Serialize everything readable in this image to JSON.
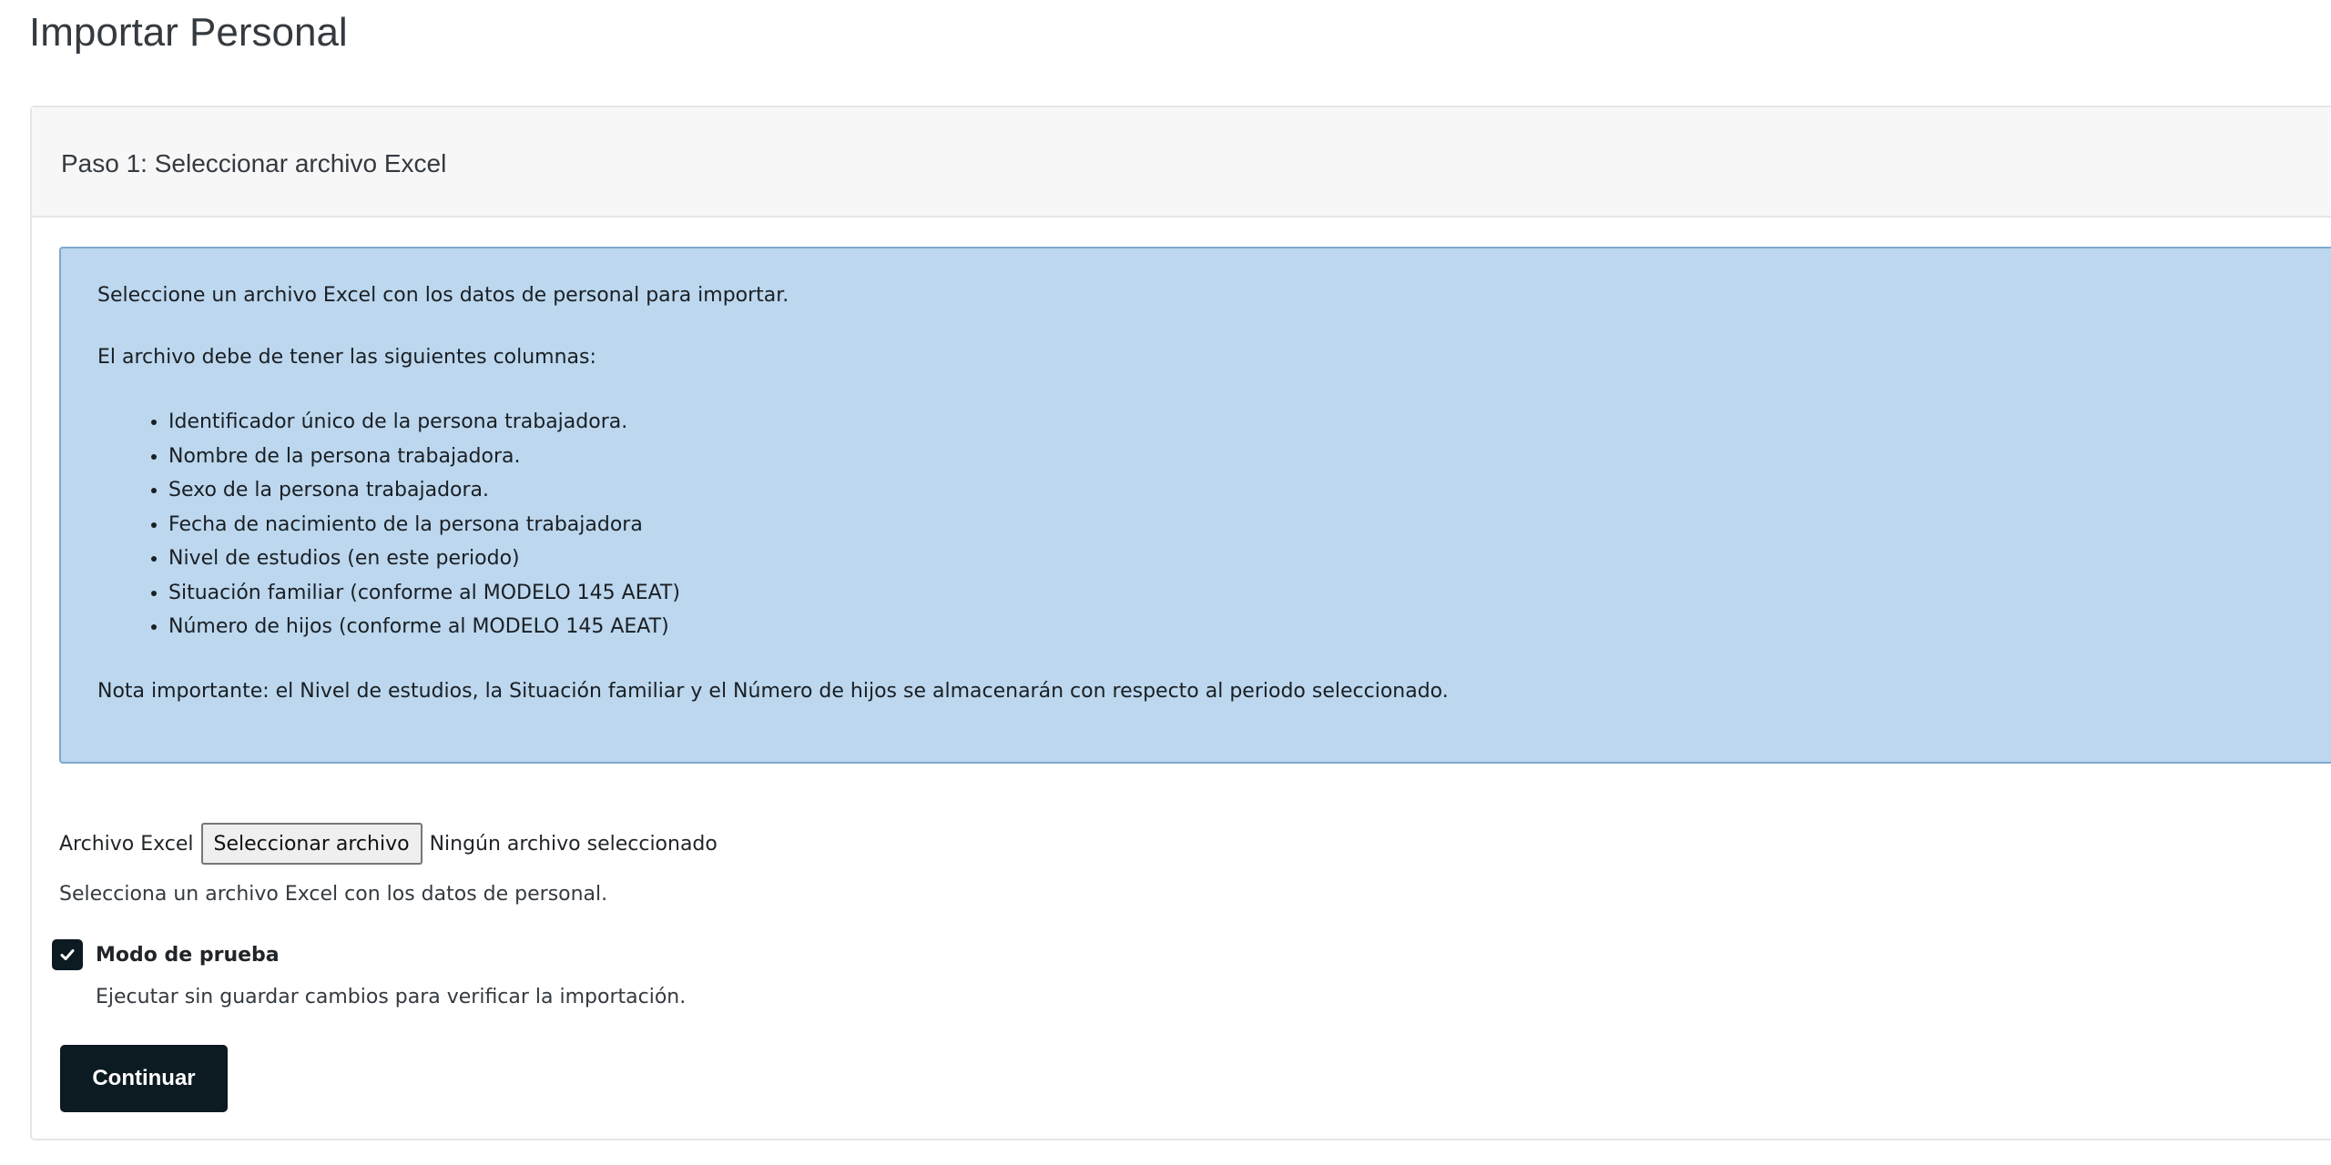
{
  "page": {
    "title": "Importar Personal"
  },
  "card": {
    "header_title": "Paso 1: Seleccionar archivo Excel"
  },
  "info_alert": {
    "intro": "Seleccione un archivo Excel con los datos de personal para importar.",
    "columns_title": "El archivo debe de tener las siguientes columnas:",
    "columns": [
      "Identificador único de la persona trabajadora.",
      "Nombre de la persona trabajadora.",
      "Sexo de la persona trabajadora.",
      "Fecha de nacimiento de la persona trabajadora",
      "Nivel de estudios (en este periodo)",
      "Situación familiar (conforme al MODELO 145 AEAT)",
      "Número de hijos (conforme al MODELO 145 AEAT)"
    ],
    "note": "Nota importante: el Nivel de estudios, la Situación familiar y el Número de hijos se almacenarán con respecto al periodo seleccionado."
  },
  "file_field": {
    "label": "Archivo Excel",
    "button_label": "Seleccionar archivo",
    "status": "Ningún archivo seleccionado",
    "help": "Selecciona un archivo Excel con los datos de personal."
  },
  "test_mode": {
    "label": "Modo de prueba",
    "checked": true,
    "help": "Ejecutar sin guardar cambios para verificar la importación."
  },
  "actions": {
    "continue_label": "Continuar"
  },
  "colors": {
    "alert_background": "#bcd7ee",
    "alert_border": "#7fa8cf",
    "primary": "#0c1a22"
  },
  "icons": {
    "checkbox": "check-icon"
  }
}
